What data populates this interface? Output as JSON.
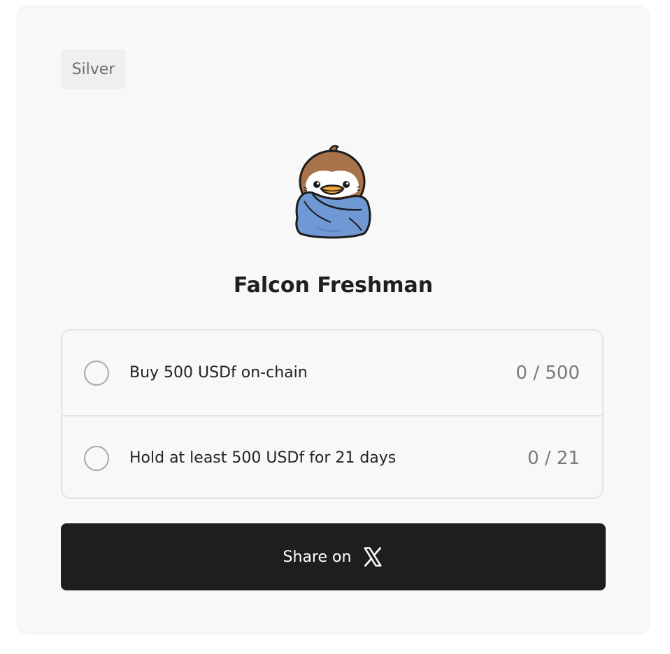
{
  "badge": {
    "tier": "Silver"
  },
  "achievement": {
    "title": "Falcon Freshman",
    "mascot_icon": "falcon-mascot-in-blanket"
  },
  "tasks": [
    {
      "label": "Buy 500 USDf on-chain",
      "progress": "0 / 500",
      "completed": false
    },
    {
      "label": "Hold at least 500 USDf for 21 days",
      "progress": "0 / 21",
      "completed": false
    }
  ],
  "share": {
    "label": "Share on",
    "icon": "x-logo-icon"
  },
  "colors": {
    "card_background": "#f8f8f8",
    "button_background": "#1e1e1f",
    "blanket_blue": "#6f98d4"
  }
}
